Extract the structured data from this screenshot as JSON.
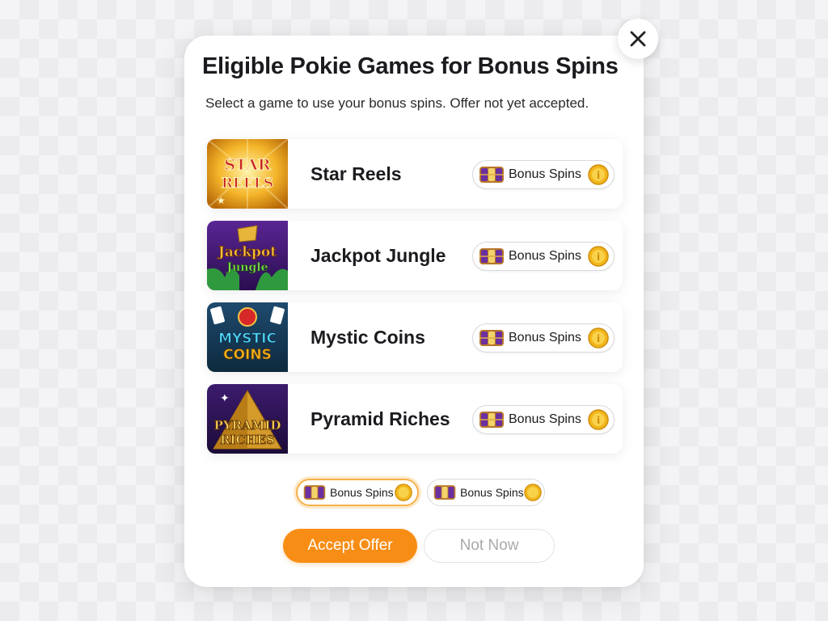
{
  "modal": {
    "title": "Eligible Pokie Games for Bonus Spins",
    "subtitle": "Select a game to use your bonus spins. Offer not yet accepted."
  },
  "close_icon": "close-icon",
  "games": [
    {
      "name": "Star Reels",
      "badge": "Bonus Spins",
      "thumb_text": [
        "STAR",
        "REELS"
      ]
    },
    {
      "name": "Jackpot Jungle",
      "badge": "Bonus Spins",
      "thumb_text": [
        "Jackpot",
        "Jungle"
      ]
    },
    {
      "name": "Mystic Coins",
      "badge": "Bonus Spins",
      "thumb_text": [
        "MYSTIC",
        "COINS"
      ]
    },
    {
      "name": "Pyramid Riches",
      "badge": "Bonus Spins",
      "thumb_text": [
        "PYRAMID",
        "RICHES"
      ]
    }
  ],
  "spin_options": [
    {
      "label": "Bonus Spins",
      "selected": true
    },
    {
      "label": "Bonus Spins",
      "selected": false
    }
  ],
  "actions": {
    "accept_label": "Accept Offer",
    "decline_label": "Not Now"
  },
  "colors": {
    "accent": "#f78d15",
    "selected_border": "#f5b14a",
    "coin": "#f2b61c"
  }
}
